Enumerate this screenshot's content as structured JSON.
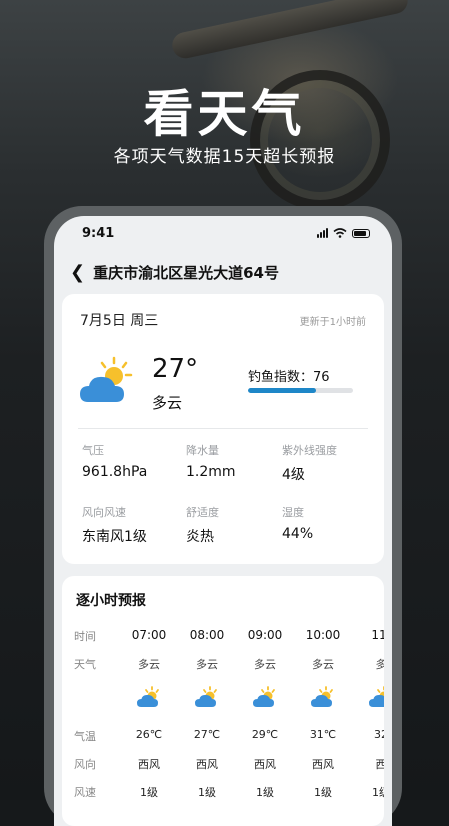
{
  "hero": {
    "title": "看天气",
    "subtitle": "各项天气数据15天超长预报"
  },
  "status_bar": {
    "time": "9:41"
  },
  "nav": {
    "back_icon": "chevron-left-icon",
    "location": "重庆市渝北区星光大道64号"
  },
  "today": {
    "date": "7月5日 周三",
    "updated": "更新于1小时前",
    "temperature": "27°",
    "condition": "多云",
    "fishing_label": "钓鱼指数：",
    "fishing_value": "76",
    "fishing_level": 0.65,
    "details": [
      {
        "label": "气压",
        "value": "961.8hPa"
      },
      {
        "label": "降水量",
        "value": "1.2mm"
      },
      {
        "label": "紫外线强度",
        "value": "4级"
      },
      {
        "label": "风向风速",
        "value": "东南风1级"
      },
      {
        "label": "舒适度",
        "value": "炎热"
      },
      {
        "label": "湿度",
        "value": "44%"
      }
    ]
  },
  "hourly": {
    "title": "逐小时预报",
    "row_labels": {
      "time": "时间",
      "weather": "天气",
      "temp": "气温",
      "wind_dir": "风向",
      "wind_speed": "风速"
    },
    "hours": [
      {
        "time": "07:00",
        "weather": "多云",
        "temp": "26℃",
        "wind_dir": "西风",
        "wind_speed": "1级"
      },
      {
        "time": "08:00",
        "weather": "多云",
        "temp": "27℃",
        "wind_dir": "西风",
        "wind_speed": "1级"
      },
      {
        "time": "09:00",
        "weather": "多云",
        "temp": "29℃",
        "wind_dir": "西风",
        "wind_speed": "1级"
      },
      {
        "time": "10:00",
        "weather": "多云",
        "temp": "31℃",
        "wind_dir": "西风",
        "wind_speed": "1级"
      },
      {
        "time": "11:",
        "weather": "多",
        "temp": "32",
        "wind_dir": "西",
        "wind_speed": "1级"
      }
    ]
  },
  "colors": {
    "accent": "#1e87c8",
    "sun": "#f6c02c",
    "cloud": "#3a8fd8"
  }
}
